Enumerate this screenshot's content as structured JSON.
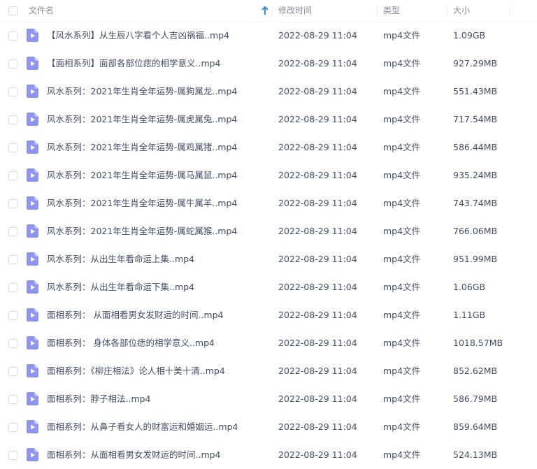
{
  "header": {
    "name_label": "文件名",
    "modified_label": "修改时间",
    "type_label": "类型",
    "size_label": "大小"
  },
  "colors": {
    "icon": "#8e93f4",
    "sort_arrow": "#2a8cf2"
  },
  "files": [
    {
      "name": "【风水系列】从生辰八字看个人吉凶祸福..mp4",
      "modified": "2022-08-29 11:04",
      "type": "mp4文件",
      "size": "1.09GB"
    },
    {
      "name": "【面相系列】面部各部位痣的相学意义..mp4",
      "modified": "2022-08-29 11:04",
      "type": "mp4文件",
      "size": "927.29MB"
    },
    {
      "name": "风水系列：2021年生肖全年运势-属狗属龙..mp4",
      "modified": "2022-08-29 11:04",
      "type": "mp4文件",
      "size": "551.43MB"
    },
    {
      "name": "风水系列：2021年生肖全年运势-属虎属兔..mp4",
      "modified": "2022-08-29 11:04",
      "type": "mp4文件",
      "size": "717.54MB"
    },
    {
      "name": "风水系列：2021年生肖全年运势-属鸡属猪..mp4",
      "modified": "2022-08-29 11:04",
      "type": "mp4文件",
      "size": "586.44MB"
    },
    {
      "name": "风水系列：2021年生肖全年运势-属马属鼠..mp4",
      "modified": "2022-08-29 11:04",
      "type": "mp4文件",
      "size": "935.24MB"
    },
    {
      "name": "风水系列：2021年生肖全年运势-属牛属羊..mp4",
      "modified": "2022-08-29 11:04",
      "type": "mp4文件",
      "size": "743.74MB"
    },
    {
      "name": "风水系列：2021年生肖全年运势-属蛇属猴..mp4",
      "modified": "2022-08-29 11:04",
      "type": "mp4文件",
      "size": "766.06MB"
    },
    {
      "name": "风水系列：从出生年看命运上集..mp4",
      "modified": "2022-08-29 11:04",
      "type": "mp4文件",
      "size": "951.99MB"
    },
    {
      "name": "风水系列：从出生年看命运下集..mp4",
      "modified": "2022-08-29 11:04",
      "type": "mp4文件",
      "size": "1.06GB"
    },
    {
      "name": "面相系列： 从面相看男女发财运的时间..mp4",
      "modified": "2022-08-29 11:04",
      "type": "mp4文件",
      "size": "1.11GB"
    },
    {
      "name": "面相系列： 身体各部位痣的相学意义..mp4",
      "modified": "2022-08-29 11:04",
      "type": "mp4文件",
      "size": "1018.57MB"
    },
    {
      "name": "面相系列：《柳庄相法》论人相十美十清..mp4",
      "modified": "2022-08-29 11:04",
      "type": "mp4文件",
      "size": "852.62MB"
    },
    {
      "name": "面相系列：脖子相法..mp4",
      "modified": "2022-08-29 11:04",
      "type": "mp4文件",
      "size": "586.79MB"
    },
    {
      "name": "面相系列：从鼻子看女人的财富运和婚姻运..mp4",
      "modified": "2022-08-29 11:04",
      "type": "mp4文件",
      "size": "859.64MB"
    },
    {
      "name": "面相系列：从面相看男女发财运的时间..mp4",
      "modified": "2022-08-29 11:04",
      "type": "mp4文件",
      "size": "524.13MB"
    }
  ]
}
